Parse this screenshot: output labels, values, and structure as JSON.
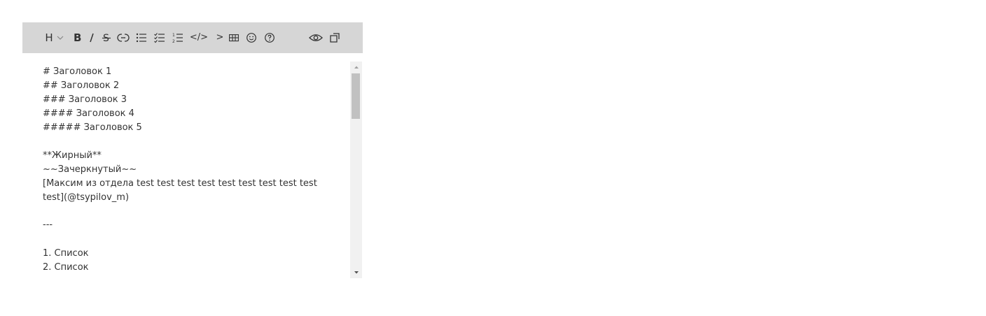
{
  "toolbar": {
    "heading_label": "H",
    "code_label": "</>",
    "quote_label": ">",
    "icons": {
      "heading": "heading-icon",
      "heading_menu": "chevron-down-icon",
      "bold": "bold-icon",
      "italic": "italic-icon",
      "strike": "strikethrough-icon",
      "link": "link-icon",
      "bullet_list": "bullet-list-icon",
      "checklist": "checklist-icon",
      "numbered_list": "numbered-list-icon",
      "code": "code-icon",
      "quote": "quote-icon",
      "table": "table-icon",
      "emoji": "emoji-icon",
      "help": "help-icon",
      "preview": "eye-icon",
      "fullscreen": "fullscreen-icon"
    },
    "background": "#d6d6d6"
  },
  "editor": {
    "lines": [
      "# Заголовок 1",
      "## Заголовок 2",
      "### Заголовок 3",
      "#### Заголовок 4",
      "##### Заголовок 5",
      "",
      "**Жирный**",
      "~~Зачеркнутый~~",
      "[Максим из отдела test test test test test test test test test",
      "test](@tsypilov_m)",
      "",
      "---",
      "",
      "1. Список",
      "2. Список"
    ]
  },
  "scrollbar": {
    "up_icon": "scroll-up-icon",
    "down_icon": "scroll-down-icon",
    "position": 0.0
  }
}
